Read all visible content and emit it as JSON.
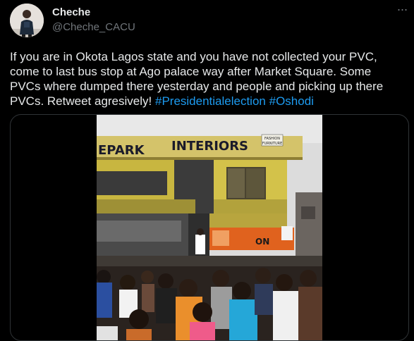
{
  "author": {
    "name": "Cheche",
    "handle": "@Cheche_CACU"
  },
  "more_icon": "more-horizontal-icon",
  "tweet": {
    "text": "If you are in Okota Lagos state and you have not collected your PVC, come to last bus stop at Ago palace way after Market Square. Some PVCs where dumped there yesterday and people and picking up there PVCs. Retweet agresively!",
    "hashtags": [
      "#Presidentialelection",
      "#Oshodi"
    ]
  },
  "media": {
    "sign_left": "EPARK",
    "sign_main": "INTERIORS",
    "sign_small_1": "FASHION",
    "sign_small_2": "FURNITURE",
    "banner_text": "ON"
  },
  "colors": {
    "background": "#000000",
    "text": "#e7e9ea",
    "secondary": "#71767b",
    "link": "#1d9bf0",
    "border": "#2f3336"
  }
}
